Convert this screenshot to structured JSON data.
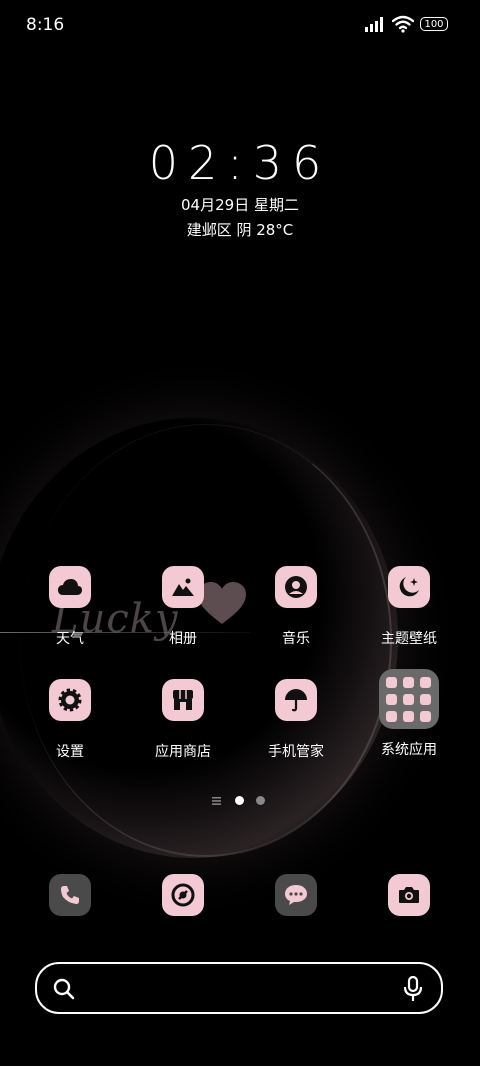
{
  "status_bar": {
    "time": "8:16",
    "battery": "100"
  },
  "clock_widget": {
    "time": "02:36",
    "date": "04月29日 星期二",
    "weather": "建邺区 阴 28°C"
  },
  "wallpaper_text": "Lucky",
  "apps_row1": [
    {
      "label": "天气",
      "icon": "cloud-icon"
    },
    {
      "label": "相册",
      "icon": "mountain-photo-icon"
    },
    {
      "label": "音乐",
      "icon": "music-disc-icon"
    },
    {
      "label": "主题壁纸",
      "icon": "moon-star-icon"
    }
  ],
  "apps_row2": [
    {
      "label": "设置",
      "icon": "gear-icon"
    },
    {
      "label": "应用商店",
      "icon": "store-icon"
    },
    {
      "label": "手机管家",
      "icon": "umbrella-icon"
    },
    {
      "label": "系统应用",
      "icon": "folder-icon"
    }
  ],
  "dock": [
    "phone-icon",
    "browser-icon",
    "message-icon",
    "camera-icon"
  ],
  "search": {
    "placeholder": ""
  },
  "colors": {
    "icon_bg": "#f3c9d3",
    "icon_fg": "#111111",
    "dock_dark": "#4a4a4a"
  }
}
